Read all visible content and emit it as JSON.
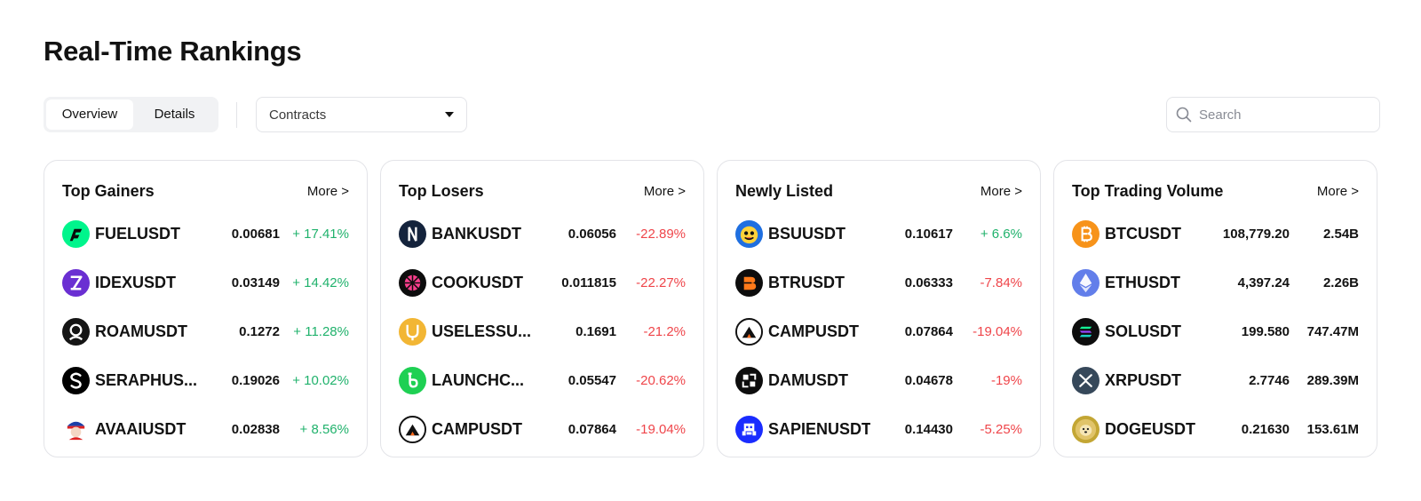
{
  "page": {
    "title": "Real-Time Rankings"
  },
  "toolbar": {
    "overview_label": "Overview",
    "details_label": "Details",
    "contracts_label": "Contracts",
    "search_placeholder": "Search"
  },
  "colors": {
    "up": "#20b26c",
    "down": "#ef454a"
  },
  "cards": [
    {
      "title": "Top Gainers",
      "more_label": "More >",
      "rows": [
        {
          "symbol": "FUELUSDT",
          "price": "0.00681",
          "change": "+ 17.41%",
          "direction": "up",
          "icon": "fuel-icon"
        },
        {
          "symbol": "IDEXUSDT",
          "price": "0.03149",
          "change": "+ 14.42%",
          "direction": "up",
          "icon": "idex-icon"
        },
        {
          "symbol": "ROAMUSDT",
          "price": "0.1272",
          "change": "+ 11.28%",
          "direction": "up",
          "icon": "roam-icon"
        },
        {
          "symbol": "SERAPHUS...",
          "price": "0.19026",
          "change": "+ 10.02%",
          "direction": "up",
          "icon": "seraph-icon"
        },
        {
          "symbol": "AVAAIUSDT",
          "price": "0.02838",
          "change": "+ 8.56%",
          "direction": "up",
          "icon": "avaai-icon"
        }
      ]
    },
    {
      "title": "Top Losers",
      "more_label": "More >",
      "rows": [
        {
          "symbol": "BANKUSDT",
          "price": "0.06056",
          "change": "-22.89%",
          "direction": "down",
          "icon": "bank-icon"
        },
        {
          "symbol": "COOKUSDT",
          "price": "0.011815",
          "change": "-22.27%",
          "direction": "down",
          "icon": "cook-icon"
        },
        {
          "symbol": "USELESSU...",
          "price": "0.1691",
          "change": "-21.2%",
          "direction": "down",
          "icon": "useless-icon"
        },
        {
          "symbol": "LAUNCHC...",
          "price": "0.05547",
          "change": "-20.62%",
          "direction": "down",
          "icon": "launchcoin-icon"
        },
        {
          "symbol": "CAMPUSDT",
          "price": "0.07864",
          "change": "-19.04%",
          "direction": "down",
          "icon": "camp-icon"
        }
      ]
    },
    {
      "title": "Newly Listed",
      "more_label": "More >",
      "rows": [
        {
          "symbol": "BSUUSDT",
          "price": "0.10617",
          "change": "+ 6.6%",
          "direction": "up",
          "icon": "bsu-icon"
        },
        {
          "symbol": "BTRUSDT",
          "price": "0.06333",
          "change": "-7.84%",
          "direction": "down",
          "icon": "btr-icon"
        },
        {
          "symbol": "CAMPUSDT",
          "price": "0.07864",
          "change": "-19.04%",
          "direction": "down",
          "icon": "camp-icon"
        },
        {
          "symbol": "DAMUSDT",
          "price": "0.04678",
          "change": "-19%",
          "direction": "down",
          "icon": "dam-icon"
        },
        {
          "symbol": "SAPIENUSDT",
          "price": "0.14430",
          "change": "-5.25%",
          "direction": "down",
          "icon": "sapien-icon"
        }
      ]
    },
    {
      "title": "Top Trading Volume",
      "more_label": "More >",
      "rows": [
        {
          "symbol": "BTCUSDT",
          "price": "108,779.20",
          "change": "2.54B",
          "direction": "vol",
          "icon": "bitcoin-icon"
        },
        {
          "symbol": "ETHUSDT",
          "price": "4,397.24",
          "change": "2.26B",
          "direction": "vol",
          "icon": "ethereum-icon"
        },
        {
          "symbol": "SOLUSDT",
          "price": "199.580",
          "change": "747.47M",
          "direction": "vol",
          "icon": "solana-icon"
        },
        {
          "symbol": "XRPUSDT",
          "price": "2.7746",
          "change": "289.39M",
          "direction": "vol",
          "icon": "xrp-icon"
        },
        {
          "symbol": "DOGEUSDT",
          "price": "0.21630",
          "change": "153.61M",
          "direction": "vol",
          "icon": "dogecoin-icon"
        }
      ]
    }
  ]
}
